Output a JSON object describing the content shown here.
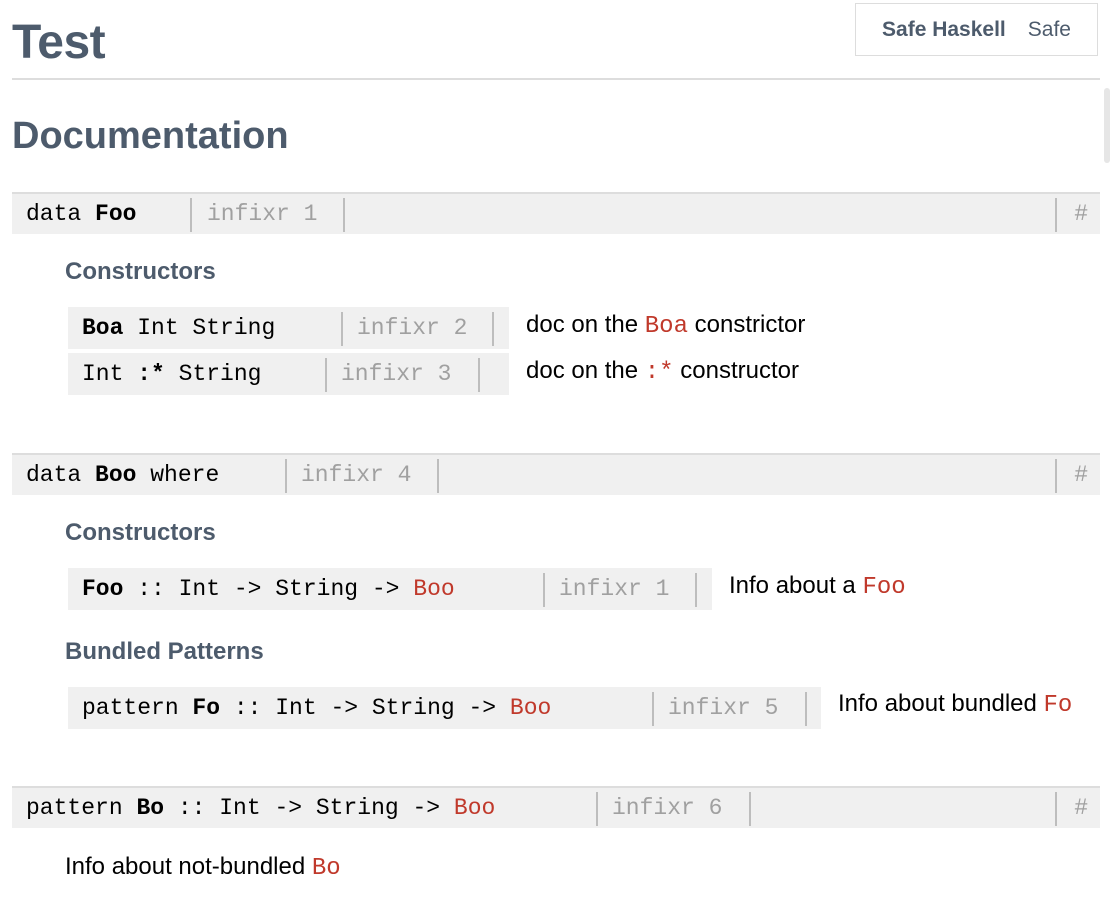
{
  "header": {
    "title": "Test",
    "safety_label": "Safe Haskell",
    "safety_value": "Safe",
    "section": "Documentation"
  },
  "subheadings": {
    "constructors": "Constructors",
    "bundled_patterns": "Bundled Patterns"
  },
  "decls": [
    {
      "keyword": "data",
      "name": "Foo",
      "rest": "",
      "fixity": "infixr 1",
      "anchor": "#",
      "constructors": [
        {
          "name": "Boa",
          "rest": " Int String",
          "fixity": "infixr 2",
          "doc_pre": "doc on the ",
          "doc_code": "Boa",
          "doc_post": " constrictor"
        },
        {
          "name": "Int",
          "op": " :* ",
          "rest": "String",
          "fixity": "infixr 3",
          "doc_pre": "doc on the ",
          "doc_code": ":*",
          "doc_post": " constructor"
        }
      ]
    },
    {
      "keyword": "data",
      "name": "Boo",
      "rest": " where",
      "fixity": "infixr 4",
      "anchor": "#",
      "constructors": [
        {
          "name": "Foo",
          "rest": " :: Int -> String -> ",
          "link": "Boo",
          "fixity": "infixr 1",
          "doc_pre": "Info about a ",
          "doc_code": "Foo",
          "doc_post": ""
        }
      ],
      "patterns": [
        {
          "keyword": "pattern ",
          "name": "Fo",
          "rest": " :: Int -> String -> ",
          "link": "Boo",
          "fixity": "infixr 5",
          "doc_pre": "Info about bundled ",
          "doc_code": "Fo",
          "doc_post": ""
        }
      ]
    },
    {
      "keyword": "pattern",
      "name": "Bo",
      "rest": " :: Int -> String -> ",
      "link": "Boo",
      "fixity": "infixr 6",
      "anchor": "#",
      "doc_pre": "Info about not-bundled ",
      "doc_code": "Bo"
    }
  ]
}
